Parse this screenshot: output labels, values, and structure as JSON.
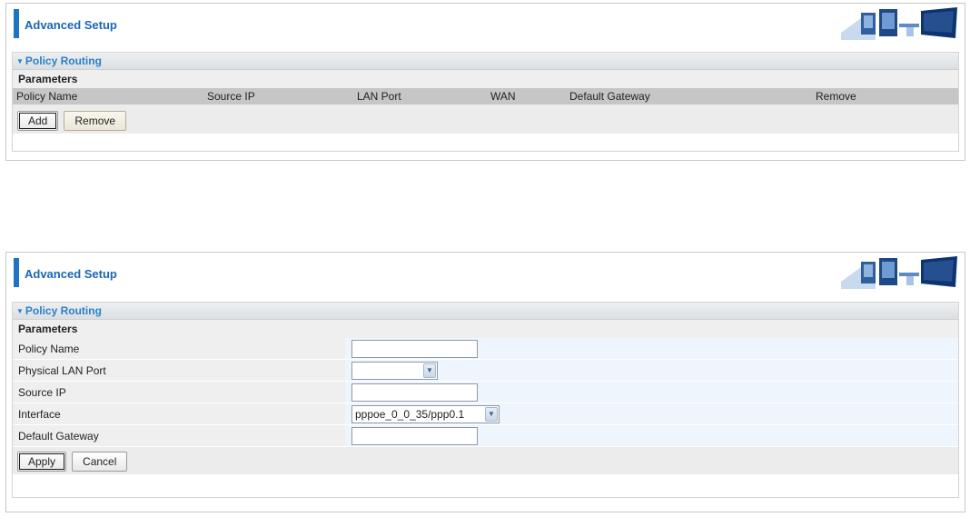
{
  "panel1": {
    "header": {
      "title": "Advanced Setup"
    },
    "section": {
      "title": "Policy Routing",
      "params_label": "Parameters",
      "columns": [
        "Policy Name",
        "Source IP",
        "LAN Port",
        "WAN",
        "Default Gateway",
        "Remove"
      ],
      "buttons": {
        "add": "Add",
        "remove": "Remove"
      }
    }
  },
  "panel2": {
    "header": {
      "title": "Advanced Setup"
    },
    "section": {
      "title": "Policy Routing",
      "params_label": "Parameters",
      "fields": {
        "policy_name": {
          "label": "Policy Name",
          "value": ""
        },
        "lan_port": {
          "label": "Physical LAN Port",
          "value": ""
        },
        "source_ip": {
          "label": "Source IP",
          "value": ""
        },
        "interface": {
          "label": "Interface",
          "value": "pppoe_0_0_35/ppp0.1"
        },
        "default_gateway": {
          "label": "Default Gateway",
          "value": ""
        }
      },
      "buttons": {
        "apply": "Apply",
        "cancel": "Cancel"
      }
    }
  },
  "icons": {
    "logo": "computer-network-logo",
    "collapse": "triangle-down-icon",
    "dropdown": "chevron-down-icon"
  },
  "colors": {
    "accent": "#1e73c4",
    "title_text": "#1a66b3",
    "section_title": "#2a7fc9",
    "field_bg": "#eef5fc",
    "label_bg": "#efefef",
    "table_header_bg": "#c6c6c6"
  }
}
